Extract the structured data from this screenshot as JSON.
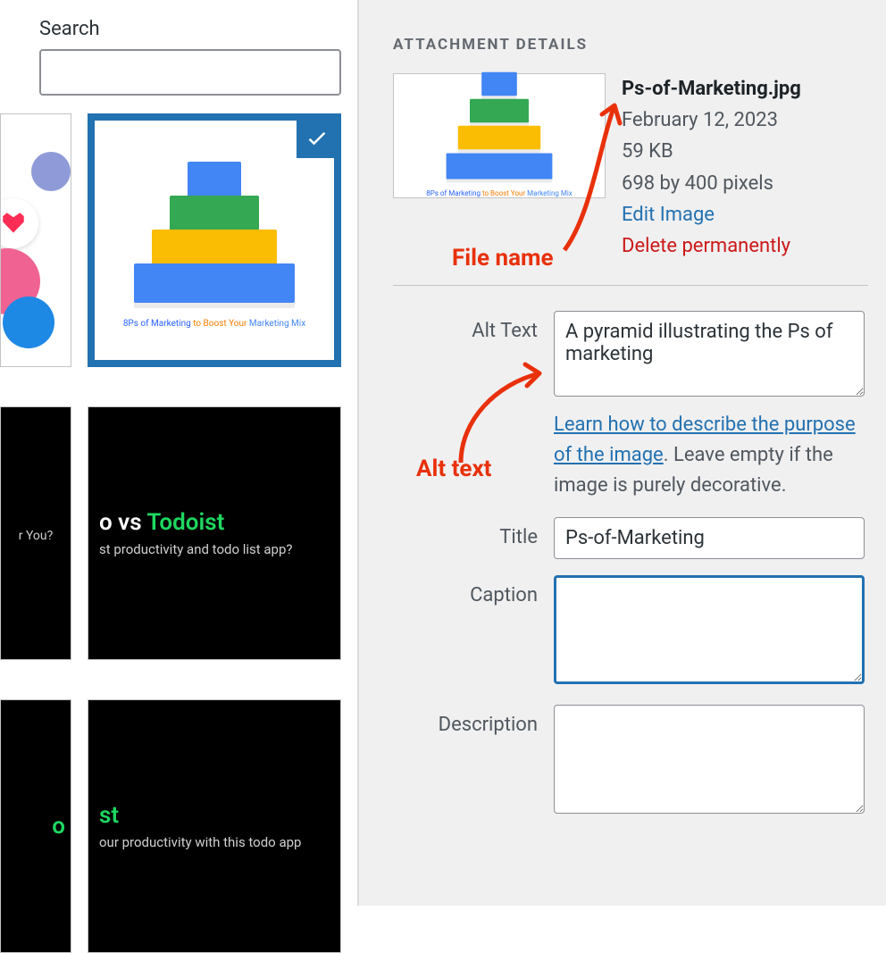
{
  "search": {
    "label": "Search",
    "value": ""
  },
  "thumbs": {
    "selected_caption_1": "8Ps of Marketing ",
    "selected_caption_2": "to Boost Your ",
    "selected_caption_3": "Marketing Mix",
    "dark1_title_a": "o vs ",
    "dark1_title_b": "Todoist",
    "dark1_sub": "st productivity and todo list app?",
    "dark1p_sub": "r You?",
    "dark2_title_a": "o",
    "dark2_title_b": "st",
    "dark2_sub": "our productivity with this todo app"
  },
  "details": {
    "section_title": "Attachment Details",
    "filename": "Ps-of-Marketing.jpg",
    "date": "February 12, 2023",
    "size": "59 KB",
    "dimensions": "698 by 400 pixels",
    "edit_label": "Edit Image",
    "delete_label": "Delete permanently"
  },
  "form": {
    "alt_label": "Alt Text",
    "alt_value": "A pyramid illustrating the Ps of marketing",
    "alt_help_link": "Learn how to describe the purpose of the image",
    "alt_help_rest": ". Leave empty if the image is purely decorative.",
    "title_label": "Title",
    "title_value": "Ps-of-Marketing",
    "caption_label": "Caption",
    "caption_value": "",
    "description_label": "Description",
    "description_value": ""
  },
  "annotations": {
    "file_name": "File name",
    "alt_text": "Alt text"
  }
}
